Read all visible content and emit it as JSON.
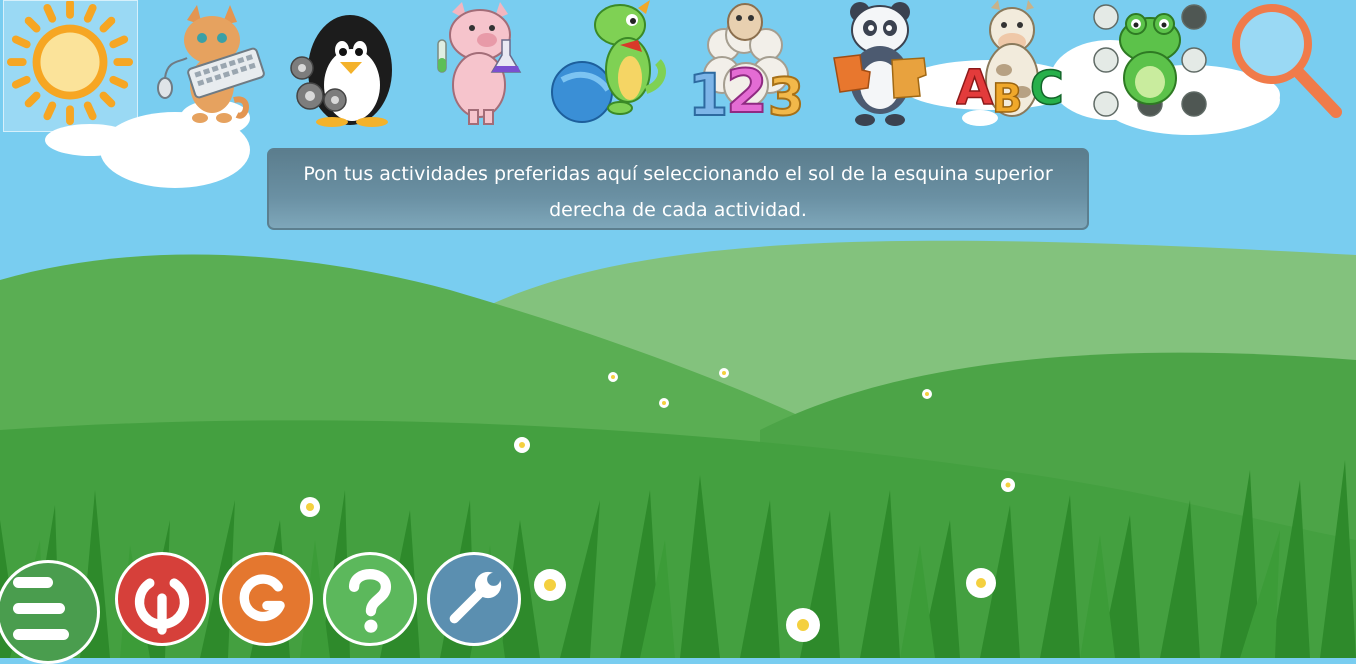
{
  "categories": [
    {
      "name": "favorites",
      "icon": "sun-icon"
    },
    {
      "name": "computer",
      "icon": "cat-keyboard-icon"
    },
    {
      "name": "discovery",
      "icon": "penguin-gears-icon"
    },
    {
      "name": "experiments",
      "icon": "pig-scientist-icon"
    },
    {
      "name": "fun",
      "icon": "dragon-ball-icon"
    },
    {
      "name": "math",
      "icon": "sheep-numbers-icon"
    },
    {
      "name": "puzzle",
      "icon": "panda-puzzle-icon"
    },
    {
      "name": "reading",
      "icon": "cow-letters-icon"
    },
    {
      "name": "strategy",
      "icon": "frog-game-icon"
    },
    {
      "name": "search",
      "icon": "magnifier-icon"
    }
  ],
  "instruction": {
    "text": "Pon tus actividades preferidas aquí seleccionando el sol de la esquina superior derecha de cada actividad."
  },
  "controls": [
    {
      "name": "menu",
      "icon": "hamburger-icon",
      "color": "#4a9d4e"
    },
    {
      "name": "quit",
      "icon": "power-icon",
      "color": "#d6403a"
    },
    {
      "name": "about",
      "icon": "gcompris-g-icon",
      "color": "#e4772f"
    },
    {
      "name": "help",
      "icon": "question-icon",
      "color": "#5cb85c"
    },
    {
      "name": "settings",
      "icon": "wrench-icon",
      "color": "#5b8fb0"
    }
  ],
  "colors": {
    "sky": "#79cdf0",
    "hill_light": "#83c27d",
    "hill_mid": "#5aae53",
    "hill_dark": "#3f9a3c",
    "grass": "#2e8a2b",
    "instruction_bg": "#5b7d8d"
  }
}
